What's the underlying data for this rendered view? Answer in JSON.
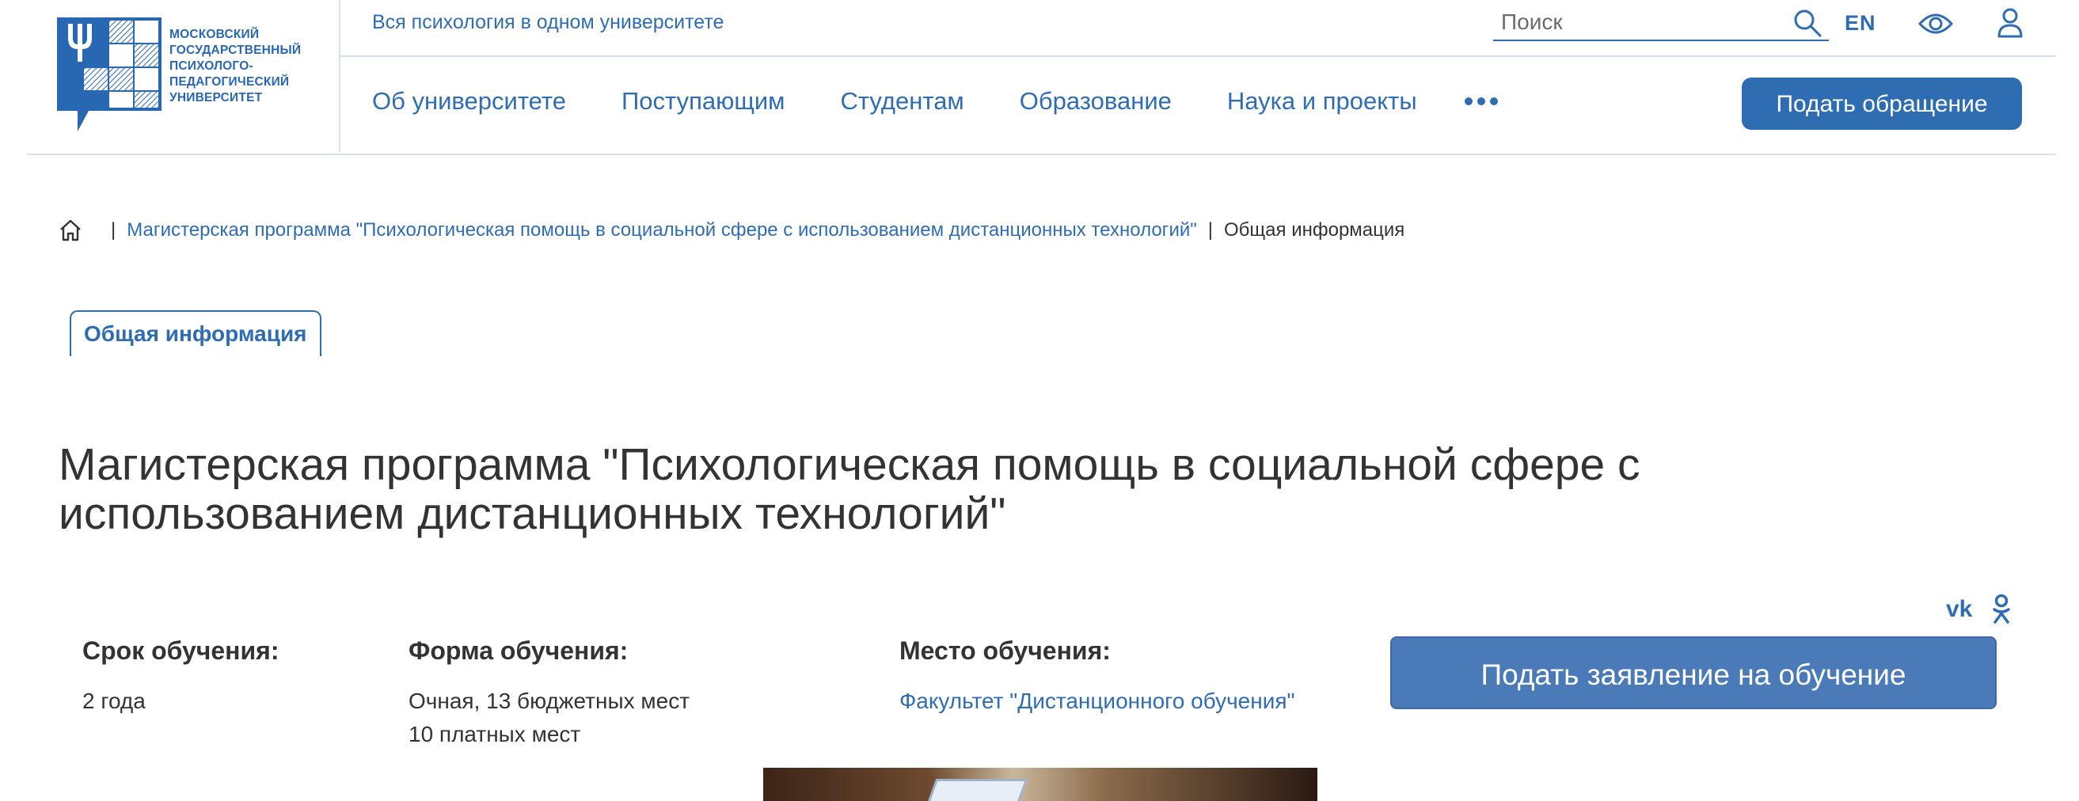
{
  "header": {
    "logo_lines": [
      "МОСКОВСКИЙ",
      "ГОСУДАРСТВЕННЫЙ",
      "ПСИХОЛОГО-",
      "ПЕДАГОГИЧЕСКИЙ",
      "УНИВЕРСИТЕТ"
    ],
    "tagline": "Вся психология в одном университете",
    "search_placeholder": "Поиск",
    "lang": "EN",
    "nav": [
      "Об университете",
      "Поступающим",
      "Студентам",
      "Образование",
      "Наука и проекты"
    ],
    "appeal_button": "Подать обращение"
  },
  "breadcrumb": {
    "separator": "|",
    "link": "Магистерская программа \"Психологическая помощь в социальной сфере с использованием дистанционных технологий\"",
    "current": "Общая информация"
  },
  "tab": "Общая информация",
  "title_line1": "Магистерская программа \"Психологическая помощь в социальной сфере с",
  "title_line2": "использованием дистанционных технологий\"",
  "info": {
    "duration_label": "Срок обучения:",
    "duration_value": "2 года",
    "form_label": "Форма обучения:",
    "form_value_1": "Очная, 13 бюджетных мест",
    "form_value_2": "10 платных мест",
    "place_label": "Место обучения:",
    "place_value": "Факультет \"Дистанционного обучения\""
  },
  "apply_button": "Подать заявление на обучение",
  "colors": {
    "primary": "#2f6db3",
    "button_apply": "#4a7ab8",
    "text": "#333333",
    "divider": "#d7e2ee"
  },
  "icons": [
    "home-icon",
    "search-icon",
    "eye-icon",
    "user-icon",
    "more-dots-icon",
    "vk-icon",
    "ok-icon"
  ]
}
